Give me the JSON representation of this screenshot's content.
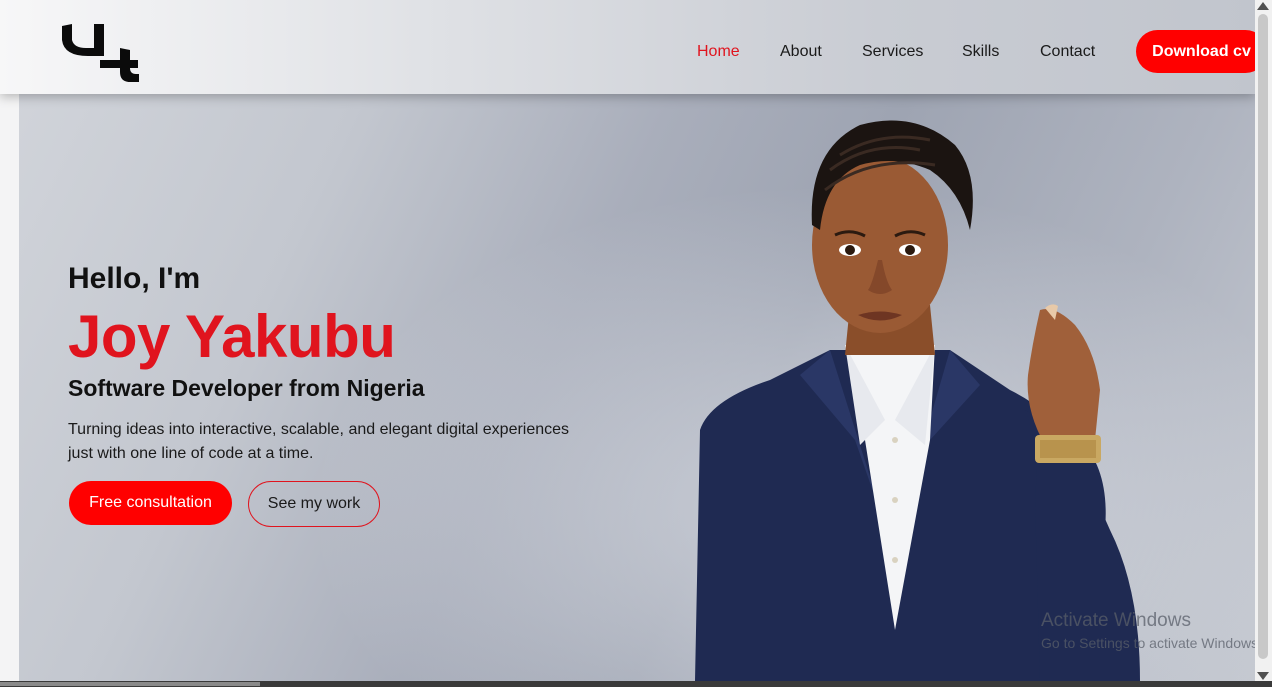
{
  "header": {
    "logo_icon": "yt-monogram-logo",
    "nav": [
      {
        "label": "Home",
        "active": true
      },
      {
        "label": "About",
        "active": false
      },
      {
        "label": "Services",
        "active": false
      },
      {
        "label": "Skills",
        "active": false
      },
      {
        "label": "Contact",
        "active": false
      }
    ],
    "cv_button": "Download cv"
  },
  "hero": {
    "greeting": "Hello, I'm",
    "name": "Joy Yakubu",
    "role": "Software Developer from Nigeria",
    "description": "Turning ideas into interactive, scalable, and elegant digital experiences just with one line of code at a time.",
    "primary_button": "Free consultation",
    "secondary_button": "See my work",
    "portrait_icon": "portrait-image"
  },
  "watermark": {
    "title": "Activate Windows",
    "subtitle": "Go to Settings to activate Windows."
  },
  "colors": {
    "accent": "#ff0000",
    "name_red": "#e0141e",
    "text": "#111111"
  }
}
